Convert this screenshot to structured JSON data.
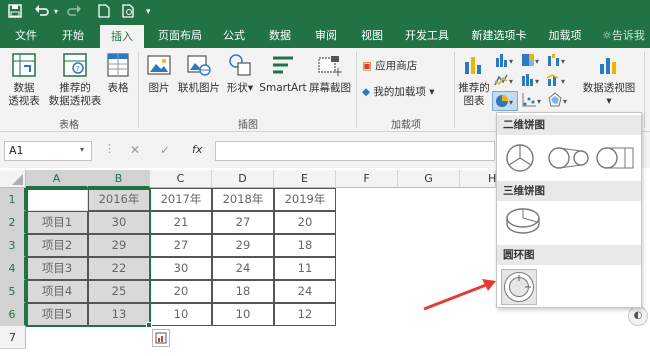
{
  "qat": {
    "save_icon": "save-icon",
    "undo_icon": "undo-icon",
    "redo_icon": "redo-icon",
    "new_icon": "new-file-icon",
    "preview_icon": "print-preview-icon"
  },
  "tabs": [
    "文件",
    "开始",
    "插入",
    "页面布局",
    "公式",
    "数据",
    "审阅",
    "视图",
    "开发工具",
    "新建选项卡",
    "加载项"
  ],
  "tell_me": "告诉我",
  "ribbon": {
    "pivot_table": [
      "数据",
      "透视表"
    ],
    "recommended_pivot": [
      "推荐的",
      "数据透视表"
    ],
    "table": "表格",
    "group_tables": "表格",
    "picture": "图片",
    "online_picture": "联机图片",
    "shapes": "形状",
    "smartart": "SmartArt",
    "screenshot": "屏幕截图",
    "group_illustrations": "插图",
    "store": "应用商店",
    "my_addins": "我的加载项",
    "group_addins": "加载项",
    "recommended_charts": [
      "推荐的",
      "图表"
    ],
    "pivot_chart": "数据透视图"
  },
  "formula_bar": {
    "name_box": "A1",
    "cancel": "✕",
    "enter": "✓",
    "fx": "fx",
    "formula": ""
  },
  "sheet": {
    "columns": [
      "A",
      "B",
      "C",
      "D",
      "E",
      "F",
      "G",
      "H"
    ],
    "rows": [
      "1",
      "2",
      "3",
      "4",
      "5",
      "6",
      "7"
    ],
    "header_row": [
      "",
      "2016年",
      "2017年",
      "2018年",
      "2019年"
    ],
    "data": [
      [
        "项目1",
        "30",
        "21",
        "27",
        "20"
      ],
      [
        "项目2",
        "29",
        "27",
        "29",
        "18"
      ],
      [
        "项目3",
        "22",
        "30",
        "24",
        "11"
      ],
      [
        "项目4",
        "25",
        "20",
        "18",
        "24"
      ],
      [
        "项目5",
        "13",
        "10",
        "10",
        "12"
      ]
    ]
  },
  "pie_dropdown": {
    "section_2d": "二维饼图",
    "section_3d": "三维饼图",
    "section_doughnut": "圆环图"
  },
  "colors": {
    "brand": "#217346",
    "arrow": "#e53935"
  }
}
